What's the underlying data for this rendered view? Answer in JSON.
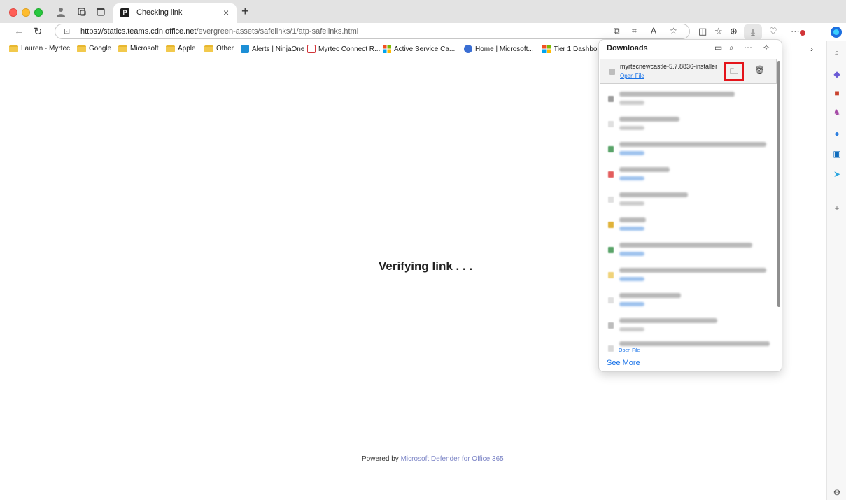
{
  "window": {
    "tab_title": "Checking link",
    "tab_favicon": "P",
    "new_tab_symbol": "+",
    "tab_close_symbol": "×"
  },
  "address_bar": {
    "url_host": "https://statics.teams.cdn.office.net",
    "url_path": "/evergreen-assets/safelinks/1/atp-safelinks.html"
  },
  "bookmarks": [
    {
      "label": "Lauren - Myrtec",
      "icon": "folder-icon"
    },
    {
      "label": "Google",
      "icon": "folder-icon"
    },
    {
      "label": "Microsoft",
      "icon": "folder-icon"
    },
    {
      "label": "Apple",
      "icon": "folder-icon"
    },
    {
      "label": "Other",
      "icon": "folder-icon"
    },
    {
      "label": "Alerts | NinjaOne",
      "icon": "ninjaone-icon",
      "color": "#1d8fd6"
    },
    {
      "label": "Myrtec Connect R...",
      "icon": "window-icon",
      "color": "#d13438"
    },
    {
      "label": "Active Service Ca...",
      "icon": "microsoft-icon"
    },
    {
      "label": "Home | Microsoft...",
      "icon": "m365-icon",
      "color": "#3a6ed3"
    },
    {
      "label": "Tier 1 Dashboard",
      "icon": "microsoft-icon"
    }
  ],
  "page": {
    "verify_text": "Verifying link . . .",
    "powered_prefix": "Powered by",
    "powered_brand": "Microsoft Defender for Office 365",
    "brand_color": "#7b84c6"
  },
  "downloads": {
    "title": "Downloads",
    "active_item": {
      "file_name": "myrtecnewcastle-5.7.8836-installer",
      "open_link": "Open File"
    },
    "last_item_open_link": "Open File",
    "see_more": "See More",
    "highlight_color": "#e4141b",
    "link_color": "#1a73e8"
  }
}
